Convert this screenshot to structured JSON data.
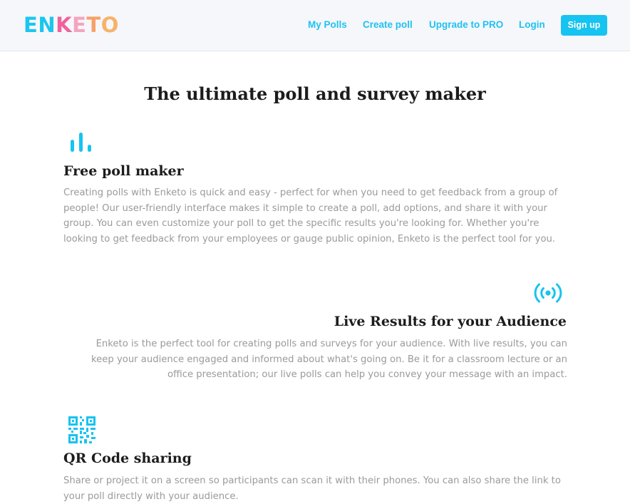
{
  "header": {
    "logo": {
      "letters": [
        {
          "char": "E",
          "color": "#1cc6ee"
        },
        {
          "char": "N",
          "color": "#1cc6ee"
        },
        {
          "char": "K",
          "color": "#f0629c"
        },
        {
          "char": "E",
          "color": "#f5a4bf"
        },
        {
          "char": "T",
          "color": "#f8a066"
        },
        {
          "char": "O",
          "color": "#f6b36a"
        }
      ]
    },
    "nav": {
      "my_polls": "My Polls",
      "create_poll": "Create poll",
      "upgrade": "Upgrade to PRO",
      "login": "Login",
      "signup": "Sign up"
    }
  },
  "main": {
    "title": "The ultimate poll and survey maker",
    "features": [
      {
        "icon": "bar-chart-icon",
        "title": "Free poll maker",
        "body": "Creating polls with Enketo is quick and easy - perfect for when you need to get feedback from a group of people! Our user-friendly interface makes it simple to create a poll, add options, and share it with your group. You can even customize your poll to get the specific results you're looking for. Whether you're looking to get feedback from your employees or gauge public opinion, Enketo is the perfect tool for you."
      },
      {
        "icon": "broadcast-icon",
        "title": "Live Results for your Audience",
        "body": "Enketo is the perfect tool for creating polls and surveys for your audience. With live results, you can keep your audience engaged and informed about what's going on. Be it for a classroom lecture or an office presentation; our live polls can help you convey your message with an impact."
      },
      {
        "icon": "qr-code-icon",
        "title": "QR Code sharing",
        "body": "Share or project it on a screen so participants can scan it with their phones. You can also share the link to your poll directly with your audience."
      }
    ]
  },
  "colors": {
    "accent": "#17c3f0",
    "heading": "#1c1c1c",
    "body_text": "#9a9a9a",
    "header_bg": "#f5f7fb"
  }
}
